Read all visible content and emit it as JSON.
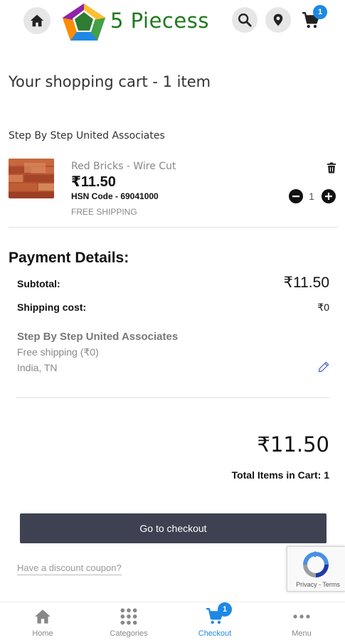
{
  "header": {
    "brand": "5 Piecess",
    "cart_count": "1"
  },
  "cart": {
    "title": "Your shopping cart - 1 item",
    "seller": "Step By Step United Associates",
    "item": {
      "name": "Red Bricks - Wire Cut",
      "price": "₹11.50",
      "hsn": "HSN Code - 69041000",
      "shipping": "FREE SHIPPING",
      "quantity": "1"
    }
  },
  "payment": {
    "title": "Payment Details:",
    "subtotal_label": "Subtotal:",
    "subtotal_value": "₹11.50",
    "shipping_label": "Shipping cost:",
    "shipping_value": "₹0",
    "seller": "Step By Step United Associates",
    "shipping_method": "Free shipping (₹0)",
    "location": "India, TN",
    "total": "₹11.50",
    "total_items": "Total Items in Cart: 1"
  },
  "actions": {
    "checkout_label": "Go to checkout",
    "coupon_label": "Have a discount coupon?"
  },
  "recaptcha": {
    "text": "Privacy - Terms"
  },
  "bottom_nav": {
    "items": [
      {
        "label": "Home",
        "icon": "home-icon"
      },
      {
        "label": "Categories",
        "icon": "grid-icon"
      },
      {
        "label": "Checkout",
        "icon": "cart-icon",
        "badge": "1"
      },
      {
        "label": "Menu",
        "icon": "more-icon"
      }
    ]
  },
  "colors": {
    "brand_green": "#1f7a1f",
    "accent_blue": "#1e88e5",
    "checkout_button": "#3d4151"
  }
}
